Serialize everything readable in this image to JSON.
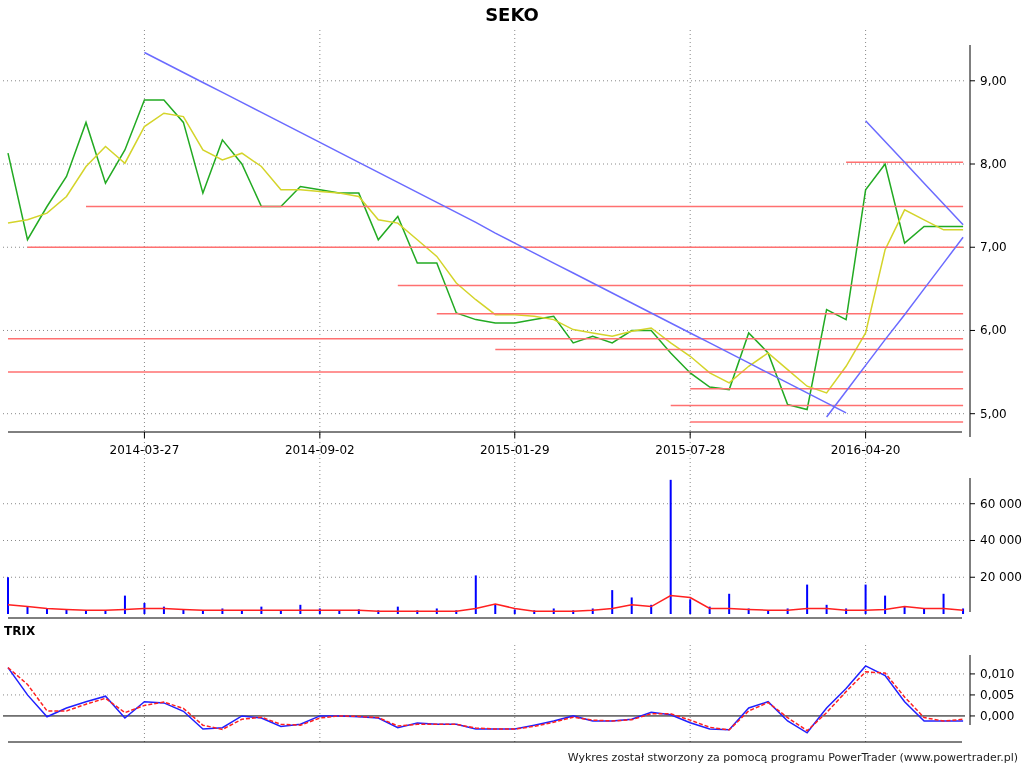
{
  "title": "SEKO",
  "charts": [
    {
      "chart_data": {
        "type": "line",
        "grid": true,
        "categories": [
          null,
          null,
          null,
          null,
          null,
          null,
          null,
          "2014-03-27",
          null,
          null,
          null,
          null,
          null,
          null,
          null,
          null,
          "2014-09-02",
          null,
          null,
          null,
          null,
          null,
          null,
          null,
          null,
          null,
          "2015-01-29",
          null,
          null,
          null,
          null,
          null,
          null,
          null,
          null,
          "2015-07-28",
          null,
          null,
          null,
          null,
          null,
          null,
          null,
          null,
          "2016-04-20",
          null,
          null,
          null,
          null,
          null
        ],
        "ylim": [
          4.78,
          9.43
        ],
        "yticks": [
          {
            "value": 5,
            "label": "5,00"
          },
          {
            "value": 6,
            "label": "6,00"
          },
          {
            "value": 7,
            "label": "7,00"
          },
          {
            "value": 8,
            "label": "8,00"
          },
          {
            "value": 9,
            "label": "9,00"
          }
        ],
        "series": [
          {
            "color": "#22aa22",
            "values": [
              8.13,
              7.09,
              7.49,
              7.85,
              8.5,
              7.77,
              8.17,
              8.77,
              8.77,
              8.5,
              7.65,
              8.29,
              8.0,
              7.49,
              7.49,
              7.73,
              7.69,
              7.65,
              7.65,
              7.09,
              7.37,
              6.81,
              6.81,
              6.21,
              6.13,
              6.09,
              6.09,
              6.13,
              6.17,
              5.85,
              5.93,
              5.85,
              6.0,
              6.0,
              5.73,
              5.49,
              5.32,
              5.29,
              5.97,
              5.73,
              5.11,
              5.05,
              6.25,
              6.13,
              7.69,
              8.0,
              7.05,
              7.25,
              7.25,
              7.25
            ]
          },
          {
            "color": "#d4d42a",
            "values": [
              7.29,
              7.33,
              7.41,
              7.61,
              7.97,
              8.21,
              8.01,
              8.45,
              8.61,
              8.57,
              8.17,
              8.05,
              8.13,
              7.97,
              7.69,
              7.69,
              7.67,
              7.65,
              7.61,
              7.33,
              7.29,
              7.09,
              6.89,
              6.57,
              6.37,
              6.19,
              6.19,
              6.17,
              6.13,
              6.01,
              5.97,
              5.93,
              5.99,
              6.03,
              5.85,
              5.69,
              5.49,
              5.37,
              5.57,
              5.73,
              5.53,
              5.33,
              5.25,
              5.57,
              5.97,
              6.97,
              7.45,
              7.33,
              7.21,
              7.21
            ]
          },
          {
            "color": "#ff7070",
            "values": [
              null,
              null,
              null,
              null,
              null,
              null,
              null,
              null,
              null,
              null,
              null,
              null,
              null,
              null,
              null,
              null,
              null,
              null,
              null,
              null,
              null,
              null,
              null,
              null,
              null,
              null,
              null,
              null,
              null,
              null,
              null,
              null,
              null,
              null,
              null,
              null,
              null,
              null,
              null,
              null,
              null,
              null,
              null,
              8.02,
              8.02,
              8.02,
              8.02,
              8.02,
              8.02,
              8.02
            ]
          },
          {
            "color": "#ff7070",
            "values": [
              null,
              null,
              null,
              null,
              7.49,
              7.49,
              7.49,
              7.49,
              7.49,
              7.49,
              7.49,
              7.49,
              7.49,
              7.49,
              7.49,
              7.49,
              7.49,
              7.49,
              7.49,
              7.49,
              7.49,
              7.49,
              7.49,
              7.49,
              7.49,
              7.49,
              7.49,
              7.49,
              7.49,
              7.49,
              7.49,
              7.49,
              7.49,
              7.49,
              7.49,
              7.49,
              7.49,
              7.49,
              7.49,
              7.49,
              7.49,
              7.49,
              7.49,
              7.49,
              7.49,
              7.49,
              7.49,
              7.49,
              7.49,
              7.49
            ]
          },
          {
            "color": "#ff7070",
            "values": [
              null,
              7,
              7,
              7,
              7,
              7,
              7,
              7,
              7,
              7,
              7,
              7,
              7,
              7,
              7,
              7,
              7,
              7,
              7,
              7,
              7,
              7,
              7,
              7,
              7,
              7,
              7,
              7,
              7,
              7,
              7,
              7,
              7,
              7,
              7,
              7,
              7,
              7,
              7,
              7,
              7,
              7,
              7,
              7,
              7,
              7,
              7,
              7,
              7,
              7
            ]
          },
          {
            "color": "#ff7070",
            "values": [
              null,
              null,
              null,
              null,
              null,
              null,
              null,
              null,
              null,
              null,
              null,
              null,
              null,
              null,
              null,
              null,
              null,
              null,
              null,
              null,
              6.54,
              6.54,
              6.54,
              6.54,
              6.54,
              6.54,
              6.54,
              6.54,
              6.54,
              6.54,
              6.54,
              6.54,
              6.54,
              6.54,
              6.54,
              6.54,
              6.54,
              6.54,
              6.54,
              6.54,
              6.54,
              6.54,
              6.54,
              6.54,
              6.54,
              6.54,
              6.54,
              6.54,
              6.54,
              6.54
            ]
          },
          {
            "color": "#ff7070",
            "values": [
              null,
              null,
              null,
              null,
              null,
              null,
              null,
              null,
              null,
              null,
              null,
              null,
              null,
              null,
              null,
              null,
              null,
              null,
              null,
              null,
              null,
              null,
              6.2,
              6.2,
              6.2,
              6.2,
              6.2,
              6.2,
              6.2,
              6.2,
              6.2,
              6.2,
              6.2,
              6.2,
              6.2,
              6.2,
              6.2,
              6.2,
              6.2,
              6.2,
              6.2,
              6.2,
              6.2,
              6.2,
              6.2,
              6.2,
              6.2,
              6.2,
              6.2,
              6.2
            ]
          },
          {
            "color": "#ff7070",
            "values": [
              5.9,
              5.9,
              5.9,
              5.9,
              5.9,
              5.9,
              5.9,
              5.9,
              5.9,
              5.9,
              5.9,
              5.9,
              5.9,
              5.9,
              5.9,
              5.9,
              5.9,
              5.9,
              5.9,
              5.9,
              5.9,
              5.9,
              5.9,
              5.9,
              5.9,
              5.9,
              5.9,
              5.9,
              5.9,
              5.9,
              5.9,
              5.9,
              5.9,
              5.9,
              5.9,
              5.9,
              5.9,
              5.9,
              5.9,
              5.9,
              5.9,
              5.9,
              5.9,
              5.9,
              5.9,
              5.9,
              5.9,
              5.9,
              5.9,
              5.9
            ]
          },
          {
            "color": "#ff7070",
            "values": [
              null,
              null,
              null,
              null,
              null,
              null,
              null,
              null,
              null,
              null,
              null,
              null,
              null,
              null,
              null,
              null,
              null,
              null,
              null,
              null,
              null,
              null,
              null,
              null,
              null,
              5.77,
              5.77,
              5.77,
              5.77,
              5.77,
              5.77,
              5.77,
              5.77,
              5.77,
              5.77,
              5.77,
              5.77,
              5.77,
              5.77,
              5.77,
              5.77,
              5.77,
              5.77,
              5.77,
              5.77,
              5.77,
              5.77,
              5.77,
              5.77,
              5.77
            ]
          },
          {
            "color": "#ff7070",
            "values": [
              5.5,
              5.5,
              5.5,
              5.5,
              5.5,
              5.5,
              5.5,
              5.5,
              5.5,
              5.5,
              5.5,
              5.5,
              5.5,
              5.5,
              5.5,
              5.5,
              5.5,
              5.5,
              5.5,
              5.5,
              5.5,
              5.5,
              5.5,
              5.5,
              5.5,
              5.5,
              5.5,
              5.5,
              5.5,
              5.5,
              5.5,
              5.5,
              5.5,
              5.5,
              5.5,
              5.5,
              5.5,
              5.5,
              5.5,
              5.5,
              5.5,
              5.5,
              5.5,
              5.5,
              5.5,
              5.5,
              5.5,
              5.5,
              5.5,
              5.5
            ]
          },
          {
            "color": "#ff7070",
            "values": [
              null,
              null,
              null,
              null,
              null,
              null,
              null,
              null,
              null,
              null,
              null,
              null,
              null,
              null,
              null,
              null,
              null,
              null,
              null,
              null,
              null,
              null,
              null,
              null,
              null,
              null,
              null,
              null,
              null,
              null,
              null,
              null,
              null,
              null,
              null,
              5.3,
              5.3,
              5.3,
              5.3,
              5.3,
              5.3,
              5.3,
              5.3,
              5.3,
              5.3,
              5.3,
              5.3,
              5.3,
              5.3,
              5.3
            ]
          },
          {
            "color": "#ff7070",
            "values": [
              null,
              null,
              null,
              null,
              null,
              null,
              null,
              null,
              null,
              null,
              null,
              null,
              null,
              null,
              null,
              null,
              null,
              null,
              null,
              null,
              null,
              null,
              null,
              null,
              null,
              null,
              null,
              null,
              null,
              null,
              null,
              null,
              null,
              null,
              5.1,
              5.1,
              5.1,
              5.1,
              5.1,
              5.1,
              5.1,
              5.1,
              5.1,
              5.1,
              5.1,
              5.1,
              5.1,
              5.1,
              5.1,
              5.1
            ]
          },
          {
            "color": "#ff7070",
            "values": [
              null,
              null,
              null,
              null,
              null,
              null,
              null,
              null,
              null,
              null,
              null,
              null,
              null,
              null,
              null,
              null,
              null,
              null,
              null,
              null,
              null,
              null,
              null,
              null,
              null,
              null,
              null,
              null,
              null,
              null,
              null,
              null,
              null,
              null,
              null,
              4.9,
              4.9,
              4.9,
              4.9,
              4.9,
              4.9,
              4.9,
              4.9,
              4.9,
              4.9,
              4.9,
              4.9,
              4.9,
              4.9,
              4.9
            ]
          },
          {
            "color": "#6b6bff",
            "values": [
              null,
              null,
              null,
              null,
              null,
              null,
              null,
              9.34,
              9.22,
              9.1,
              8.98,
              8.86,
              8.74,
              8.62,
              8.5,
              8.38,
              8.26,
              8.14,
              8.02,
              7.9,
              7.78,
              7.66,
              7.54,
              7.42,
              7.3,
              7.17,
              7.05,
              6.93,
              6.81,
              6.69,
              6.57,
              6.45,
              6.33,
              6.21,
              6.09,
              5.97,
              5.85,
              5.73,
              5.61,
              5.49,
              5.37,
              5.25,
              5.13,
              5.01,
              null,
              null,
              null,
              null,
              null,
              null
            ]
          },
          {
            "color": "#6b6bff",
            "values": [
              null,
              null,
              null,
              null,
              null,
              null,
              null,
              null,
              null,
              null,
              null,
              null,
              null,
              null,
              null,
              null,
              null,
              null,
              null,
              null,
              null,
              null,
              null,
              null,
              null,
              null,
              null,
              null,
              null,
              null,
              null,
              null,
              null,
              null,
              null,
              null,
              null,
              null,
              null,
              null,
              null,
              null,
              4.96,
              5.27,
              5.58,
              5.89,
              6.19,
              6.5,
              6.81,
              7.12
            ]
          },
          {
            "color": "#6b6bff",
            "values": [
              null,
              null,
              null,
              null,
              null,
              null,
              null,
              null,
              null,
              null,
              null,
              null,
              null,
              null,
              null,
              null,
              null,
              null,
              null,
              null,
              null,
              null,
              null,
              null,
              null,
              null,
              null,
              null,
              null,
              null,
              null,
              null,
              null,
              null,
              null,
              null,
              null,
              null,
              null,
              null,
              null,
              null,
              null,
              null,
              8.52,
              8.27,
              8.02,
              7.77,
              7.52,
              7.27
            ]
          }
        ]
      }
    },
    {
      "chart_data": {
        "type": "bar",
        "grid": true,
        "categories": [
          null,
          null,
          null,
          null,
          null,
          null,
          null,
          null,
          null,
          null,
          null,
          null,
          null,
          null,
          null,
          null,
          null,
          null,
          null,
          null,
          null,
          null,
          null,
          null,
          null,
          null,
          null,
          null,
          null,
          null,
          null,
          null,
          null,
          null,
          null,
          null,
          null,
          null,
          null,
          null,
          null,
          null,
          null,
          null,
          null,
          null,
          null,
          null,
          null,
          null
        ],
        "ylim": [
          0,
          74000
        ],
        "yticks": [
          {
            "value": 20000,
            "label": "20 000"
          },
          {
            "value": 40000,
            "label": "40 000"
          },
          {
            "value": 60000,
            "label": "60 000"
          }
        ],
        "series": [
          {
            "color": "#0000ff",
            "values": [
              20000,
              4000,
              3000,
              2500,
              2000,
              2000,
              10000,
              6000,
              4000,
              2500,
              2000,
              3000,
              2000,
              4000,
              2000,
              5000,
              3000,
              2000,
              2500,
              2000,
              4000,
              2000,
              3000,
              2000,
              21000,
              5000,
              2500,
              2000,
              3000,
              2000,
              3000,
              13000,
              9000,
              5000,
              73000,
              8000,
              4000,
              11000,
              3000,
              2000,
              3000,
              16000,
              5000,
              3000,
              16000,
              10000,
              4000,
              3000,
              11000,
              3000
            ]
          },
          {
            "type": "line",
            "color": "#ff2020",
            "values": [
              5000,
              4000,
              3000,
              2500,
              2000,
              2000,
              2500,
              3000,
              3000,
              2500,
              2000,
              2000,
              2000,
              2000,
              2000,
              2000,
              2000,
              2000,
              2000,
              1500,
              1500,
              1500,
              1500,
              1500,
              3000,
              5500,
              3000,
              1500,
              1500,
              1500,
              2000,
              3000,
              5000,
              4000,
              10000,
              9000,
              3000,
              3000,
              2500,
              2000,
              2000,
              3000,
              3000,
              2000,
              2000,
              2500,
              4000,
              3000,
              3000,
              2000
            ]
          }
        ]
      }
    },
    {
      "chart_data": {
        "type": "line",
        "grid": true,
        "title": "TRIX",
        "categories": [
          null,
          null,
          null,
          null,
          null,
          null,
          null,
          null,
          null,
          null,
          null,
          null,
          null,
          null,
          null,
          null,
          null,
          null,
          null,
          null,
          null,
          null,
          null,
          null,
          null,
          null,
          null,
          null,
          null,
          null,
          null,
          null,
          null,
          null,
          null,
          null,
          null,
          null,
          null,
          null,
          null,
          null,
          null,
          null,
          null,
          null,
          null,
          null,
          null,
          null
        ],
        "ylim": [
          -0.0062,
          0.0145
        ],
        "yticks": [
          {
            "value": 0,
            "label": "0,000"
          },
          {
            "value": 0.005,
            "label": "0,005"
          },
          {
            "value": 0.01,
            "label": "0,010"
          }
        ],
        "series": [
          {
            "color": "#2020ff",
            "values": [
              0.0115,
              0.005,
              -0.0002,
              0.0019,
              0.0034,
              0.0047,
              -0.0005,
              0.0034,
              0.0031,
              0.0011,
              -0.0031,
              -0.0028,
              0,
              -0.0005,
              -0.0025,
              -0.002,
              0,
              0,
              -0.0002,
              -0.0005,
              -0.0028,
              -0.0017,
              -0.002,
              -0.002,
              -0.0031,
              -0.0031,
              -0.0031,
              -0.0022,
              -0.0012,
              0,
              -0.0012,
              -0.0012,
              -0.0008,
              0.0009,
              0.0003,
              -0.0016,
              -0.0031,
              -0.0033,
              0.0019,
              0.0034,
              -0.0012,
              -0.004,
              0.0019,
              0.0065,
              0.0119,
              0.0096,
              0.0034,
              -0.0012,
              -0.0012,
              -0.0012
            ]
          },
          {
            "color": "#ff2020",
            "line_style": "dashed",
            "values": [
              0.0115,
              0.0075,
              0.0012,
              0.0012,
              0.0028,
              0.0042,
              0.0008,
              0.0025,
              0.0033,
              0.0018,
              -0.0022,
              -0.0032,
              -0.0008,
              -0.0003,
              -0.002,
              -0.0022,
              -0.0005,
              0,
              -0.0001,
              -0.0004,
              -0.0024,
              -0.002,
              -0.002,
              -0.002,
              -0.0029,
              -0.0031,
              -0.0031,
              -0.0025,
              -0.0015,
              -0.0003,
              -0.001,
              -0.0012,
              -0.0009,
              0.0005,
              0.0005,
              -0.001,
              -0.0027,
              -0.0033,
              0.0012,
              0.0032,
              -0.0004,
              -0.0035,
              0.0008,
              0.0058,
              0.0105,
              0.0102,
              0.0045,
              -0.0004,
              -0.0012,
              -0.0008
            ]
          }
        ]
      }
    }
  ],
  "footer": "Wykres został stworzony za pomocą programu PowerTrader (www.powertrader.pl)"
}
